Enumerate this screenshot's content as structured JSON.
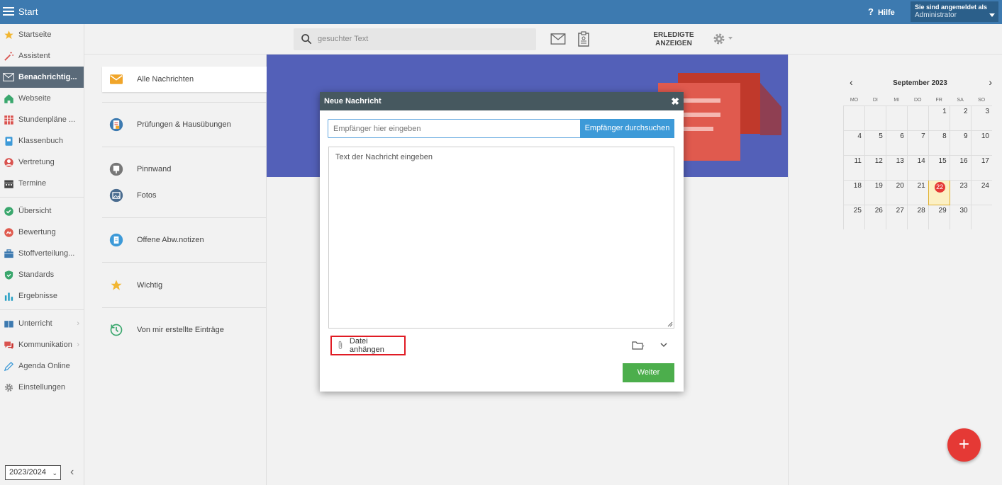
{
  "topbar": {
    "title": "Start",
    "help_label": "Hilfe",
    "login_label": "Sie sind angemeldet als",
    "login_user": "Administrator",
    "bar_color": "#3d7ab0"
  },
  "sidebar": {
    "items": [
      {
        "label": "Startseite",
        "icon": "star-icon"
      },
      {
        "label": "Assistent",
        "icon": "magic-wand-icon"
      },
      {
        "label": "Benachrichtig...",
        "icon": "envelope-icon",
        "active": true
      },
      {
        "label": "Webseite",
        "icon": "home-icon"
      },
      {
        "label": "Stundenpläne ...",
        "icon": "timetable-icon"
      },
      {
        "label": "Klassenbuch",
        "icon": "book-icon"
      },
      {
        "label": "Vertretung",
        "icon": "person-icon"
      },
      {
        "label": "Termine",
        "icon": "calendar-icon"
      },
      {
        "label": "Übersicht",
        "icon": "check-circle-icon"
      },
      {
        "label": "Bewertung",
        "icon": "rating-icon"
      },
      {
        "label": "Stoffverteilung...",
        "icon": "briefcase-icon"
      },
      {
        "label": "Standards",
        "icon": "shield-icon"
      },
      {
        "label": "Ergebnisse",
        "icon": "bar-chart-icon"
      },
      {
        "label": "Unterricht",
        "icon": "classroom-icon"
      },
      {
        "label": "Kommunikation",
        "icon": "chat-icon"
      },
      {
        "label": "Agenda Online",
        "icon": "pen-icon"
      },
      {
        "label": "Einstellungen",
        "icon": "gear-icon"
      }
    ],
    "year": "2023/2024"
  },
  "toolbar": {
    "search_placeholder": "gesuchter Text",
    "done_line1": "ERLEDIGTE",
    "done_line2": "ANZEIGEN"
  },
  "folders": [
    {
      "label": "Alle Nachrichten",
      "icon": "envelope-icon",
      "active": true
    },
    {
      "label": "Prüfungen & Hausübungen",
      "icon": "exam-icon"
    },
    {
      "label": "Pinnwand",
      "icon": "pinboard-icon"
    },
    {
      "label": "Fotos",
      "icon": "photo-icon"
    },
    {
      "label": "Offene Abw.notizen",
      "icon": "clipboard-icon"
    },
    {
      "label": "Wichtig",
      "icon": "star-icon"
    },
    {
      "label": "Von mir erstellte Einträge",
      "icon": "history-icon"
    }
  ],
  "dialog": {
    "title": "Neue Nachricht",
    "recipient_placeholder": "Empfänger hier eingeben",
    "search_recipients": "Empfänger durchsuchen",
    "text_placeholder": "Text der Nachricht eingeben",
    "attach_label": "Datei anhängen",
    "next_label": "Weiter"
  },
  "calendar": {
    "title": "September 2023",
    "weekdays": [
      "MO",
      "DI",
      "MI",
      "DO",
      "FR",
      "SA",
      "SO"
    ],
    "weeks": [
      [
        "",
        "",
        "",
        "",
        "1",
        "2",
        "3"
      ],
      [
        "4",
        "5",
        "6",
        "7",
        "8",
        "9",
        "10"
      ],
      [
        "11",
        "12",
        "13",
        "14",
        "15",
        "16",
        "17"
      ],
      [
        "18",
        "19",
        "20",
        "21",
        "22",
        "23",
        "24"
      ],
      [
        "25",
        "26",
        "27",
        "28",
        "29",
        "30",
        ""
      ]
    ],
    "today": "22"
  },
  "fab_label": "+"
}
